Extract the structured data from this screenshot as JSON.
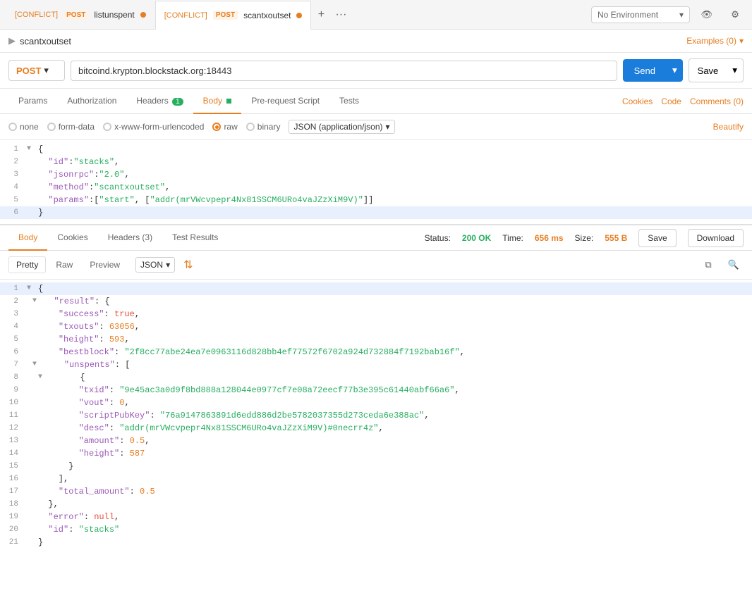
{
  "tabs": [
    {
      "id": "tab1",
      "conflict": true,
      "method": "POST",
      "name": "listunspent",
      "active": false
    },
    {
      "id": "tab2",
      "conflict": true,
      "method": "POST",
      "name": "scantxoutset",
      "active": true
    }
  ],
  "env": {
    "label": "No Environment",
    "placeholder": "No Environment"
  },
  "request": {
    "name": "scantxoutset",
    "method": "POST",
    "url": "bitcoind.krypton.blockstack.org:18443",
    "body_type": "raw",
    "json_type": "JSON (application/json)",
    "lines": [
      {
        "num": 1,
        "fold": true,
        "content": "{"
      },
      {
        "num": 2,
        "fold": false,
        "content": "  \"id\": \"stacks\","
      },
      {
        "num": 3,
        "fold": false,
        "content": "  \"jsonrpc\": \"2.0\","
      },
      {
        "num": 4,
        "fold": false,
        "content": "  \"method\": \"scantxoutset\","
      },
      {
        "num": 5,
        "fold": false,
        "content": "  \"params\": [\"start\", [\"addr(mrVWcvpepr4Nx81SSCM6URo4vaJZzXiM9V)\"]]"
      },
      {
        "num": 6,
        "fold": false,
        "content": "}"
      }
    ]
  },
  "tabs_request": {
    "params": "Params",
    "authorization": "Authorization",
    "headers": "Headers",
    "headers_count": "1",
    "body": "Body",
    "pre_request": "Pre-request Script",
    "tests": "Tests",
    "cookies": "Cookies",
    "code": "Code",
    "comments": "Comments (0)"
  },
  "response": {
    "status_label": "Status:",
    "status_code": "200 OK",
    "time_label": "Time:",
    "time_val": "656 ms",
    "size_label": "Size:",
    "size_val": "555 B",
    "save_label": "Save",
    "download_label": "Download",
    "tabs": [
      "Body",
      "Cookies",
      "Headers (3)",
      "Test Results"
    ],
    "view_tabs": [
      "Pretty",
      "Raw",
      "Preview"
    ],
    "format": "JSON",
    "lines": [
      {
        "num": 1,
        "fold": true,
        "content": "{",
        "highlight": false
      },
      {
        "num": 2,
        "fold": true,
        "content": "  \"result\": {",
        "highlight": false
      },
      {
        "num": 3,
        "fold": false,
        "content": "    \"success\": true,",
        "highlight": false
      },
      {
        "num": 4,
        "fold": false,
        "content": "    \"txouts\": 63056,",
        "highlight": false
      },
      {
        "num": 5,
        "fold": false,
        "content": "    \"height\": 593,",
        "highlight": false
      },
      {
        "num": 6,
        "fold": false,
        "content": "    \"bestblock\": \"2f8cc77abe24ea7e0963116d828bb4ef77572f6702a924d732884f7192bab16f\",",
        "highlight": false
      },
      {
        "num": 7,
        "fold": true,
        "content": "    \"unspents\": [",
        "highlight": false
      },
      {
        "num": 8,
        "fold": true,
        "content": "      {",
        "highlight": false
      },
      {
        "num": 9,
        "fold": false,
        "content": "        \"txid\": \"9e45ac3a0d9f8bd888a128044e0977cf7e08a72eecf77b3e395c61440abf66a6\",",
        "highlight": false
      },
      {
        "num": 10,
        "fold": false,
        "content": "        \"vout\": 0,",
        "highlight": false
      },
      {
        "num": 11,
        "fold": false,
        "content": "        \"scriptPubKey\": \"76a9147863891d6edd886d2be5782037355d273ceda6e388ac\",",
        "highlight": false
      },
      {
        "num": 12,
        "fold": false,
        "content": "        \"desc\": \"addr(mrVWcvpepr4Nx81SSCM6URo4vaJZzXiM9V)#0necrr4z\",",
        "highlight": false
      },
      {
        "num": 13,
        "fold": false,
        "content": "        \"amount\": 0.5,",
        "highlight": false
      },
      {
        "num": 14,
        "fold": false,
        "content": "        \"height\": 587",
        "highlight": false
      },
      {
        "num": 15,
        "fold": false,
        "content": "      }",
        "highlight": false
      },
      {
        "num": 16,
        "fold": false,
        "content": "    ],",
        "highlight": false
      },
      {
        "num": 17,
        "fold": false,
        "content": "    \"total_amount\": 0.5",
        "highlight": false
      },
      {
        "num": 18,
        "fold": false,
        "content": "  },",
        "highlight": false
      },
      {
        "num": 19,
        "fold": false,
        "content": "  \"error\": null,",
        "highlight": false
      },
      {
        "num": 20,
        "fold": false,
        "content": "  \"id\": \"stacks\"",
        "highlight": false
      },
      {
        "num": 21,
        "fold": false,
        "content": "}",
        "highlight": false
      }
    ]
  }
}
